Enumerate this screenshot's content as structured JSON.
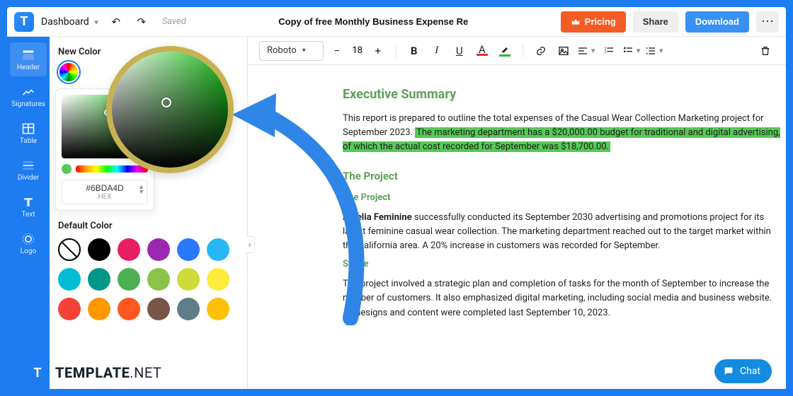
{
  "topbar": {
    "dashboard": "Dashboard",
    "saved": "Saved",
    "doc_title": "Copy of free Monthly Business Expense Re",
    "pricing": "Pricing",
    "share": "Share",
    "download": "Download"
  },
  "sidebar": {
    "items": [
      {
        "label": "Header"
      },
      {
        "label": "Signatures"
      },
      {
        "label": "Table"
      },
      {
        "label": "Divider"
      },
      {
        "label": "Text"
      },
      {
        "label": "Logo"
      }
    ]
  },
  "color_panel": {
    "new_label": "New Color",
    "hex_value": "#6BDA4D",
    "hex_label": "HEX",
    "default_label": "Default Color",
    "swatches": [
      "none",
      "#000000",
      "#e81e63",
      "#9c27b0",
      "#2979ff",
      "#00bcd4",
      "#00bcd4",
      "#009688",
      "#4caf50",
      "#8bc34a",
      "#cddc39",
      "#ffeb3b",
      "#f44336",
      "#ff9800",
      "#ff5722",
      "#795548",
      "#607d8b",
      "#ffc107"
    ]
  },
  "toolbar": {
    "font": "Roboto",
    "font_size": "18"
  },
  "document": {
    "h_exec": "Executive Summary",
    "p_exec_a": "This report is prepared to outline the total expenses of the Casual Wear Collection Marketing project for September 2023. ",
    "p_exec_hl": "The marketing department has a $20,000.00 budget for traditional and digital advertising, of which the actual cost recorded for September was $18,700.00.",
    "h_project": "The Project",
    "h_project_sub": "The Project",
    "p_proj_bold": "Amelia Feminine",
    "p_proj_rest": " successfully conducted its September 2030 advertising and promotions project for its latest feminine casual wear collection. The marketing department reached out to the target market within the California area. A 20% increase in customers was recorded for September.",
    "h_scope": "Scope",
    "p_scope": "The project involved a strategic plan and completion of tasks for the month of September to increase the number of customers. It also emphasized digital marketing, including social media and business website. All designs and content were completed last September 10, 2023."
  },
  "footer": {
    "brand": "TEMPLATE",
    "suffix": ".NET"
  },
  "chat": {
    "label": "Chat"
  }
}
